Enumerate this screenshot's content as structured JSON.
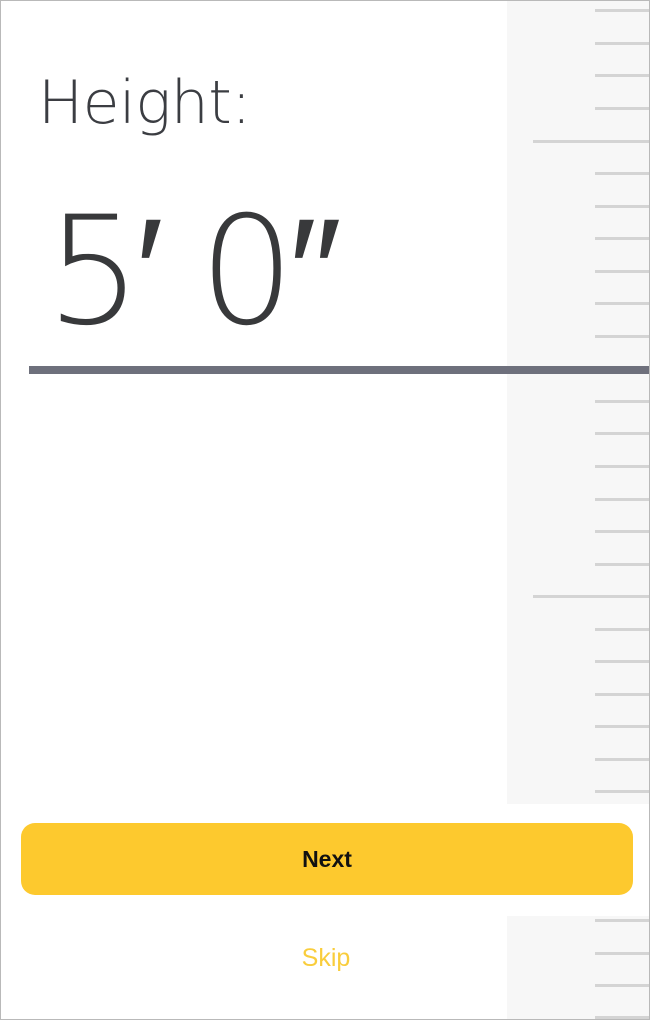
{
  "screen": {
    "title": "Height:",
    "value": "5′ 0″"
  },
  "actions": {
    "next_label": "Next",
    "skip_label": "Skip"
  },
  "colors": {
    "accent": "#fdc92e",
    "skip_text": "#f9cd3c",
    "indicator": "#6e707c",
    "ruler_background": "#f7f7f7",
    "ruler_tick": "#d4d4d4"
  }
}
